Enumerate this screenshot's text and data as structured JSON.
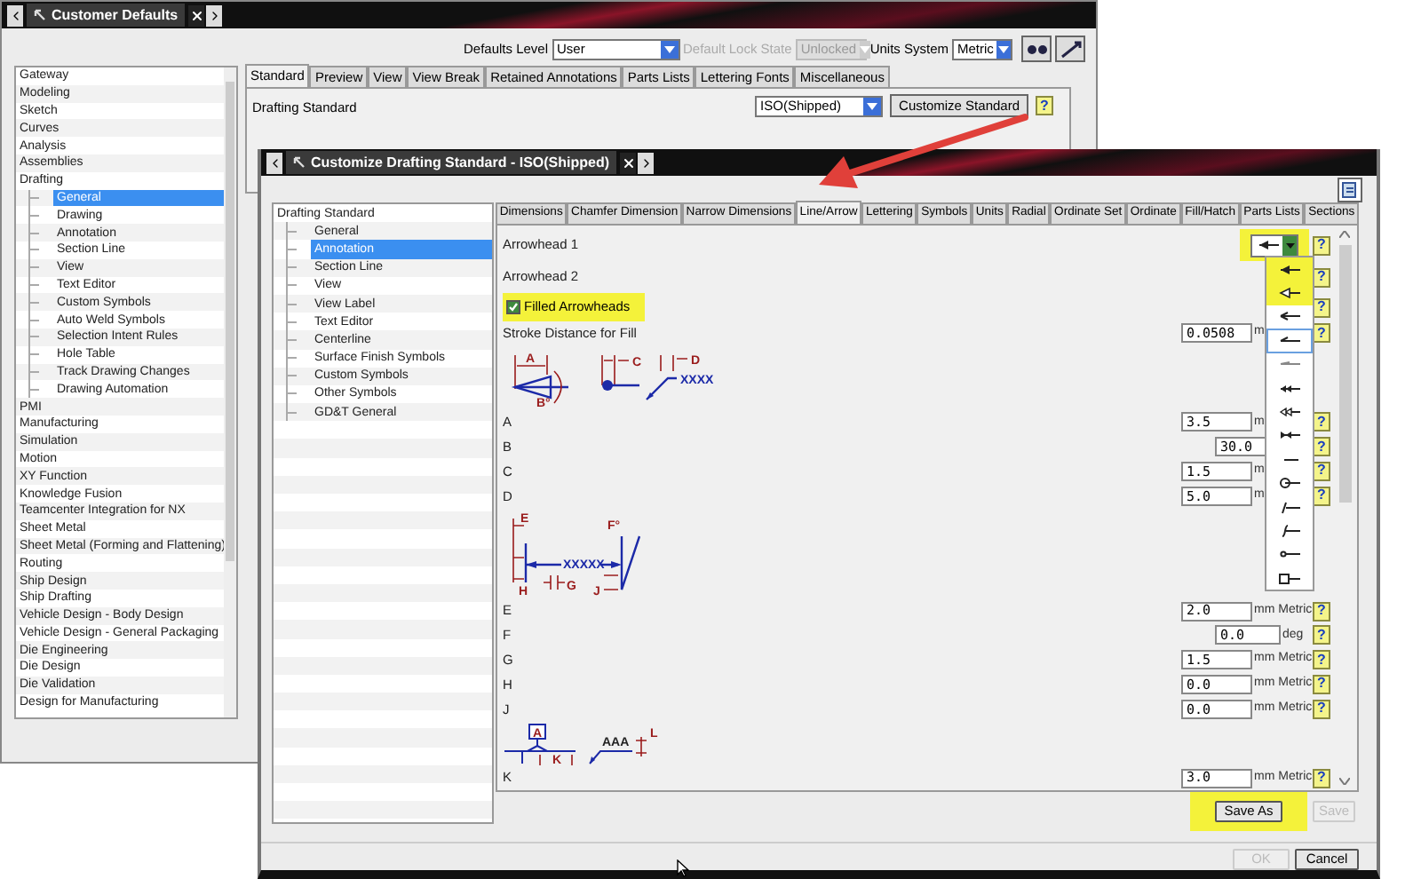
{
  "back_window": {
    "title": "Customer Defaults",
    "toolbar": {
      "defaults_level_label": "Defaults Level",
      "defaults_level": "User",
      "lock_state_label": "Default Lock State",
      "lock_state": "Unlocked",
      "lock_disabled": true,
      "units_label": "Units System",
      "units": "Metric"
    },
    "tree": [
      {
        "label": "Gateway",
        "selected": false
      },
      {
        "label": "Modeling",
        "selected": false
      },
      {
        "label": "Sketch",
        "selected": false
      },
      {
        "label": "Curves",
        "selected": false
      },
      {
        "label": "Analysis",
        "selected": false
      },
      {
        "label": "Assemblies",
        "selected": false
      },
      {
        "label": "Drafting",
        "selected": false,
        "children": [
          {
            "label": "General",
            "selected": true
          },
          {
            "label": "Drawing",
            "selected": false
          },
          {
            "label": "Annotation",
            "selected": false
          },
          {
            "label": "Section Line",
            "selected": false
          },
          {
            "label": "View",
            "selected": false
          },
          {
            "label": "Text Editor",
            "selected": false
          },
          {
            "label": "Custom Symbols",
            "selected": false
          },
          {
            "label": "Auto Weld Symbols",
            "selected": false
          },
          {
            "label": "Selection Intent Rules",
            "selected": false
          },
          {
            "label": "Hole Table",
            "selected": false
          },
          {
            "label": "Track Drawing Changes",
            "selected": false
          },
          {
            "label": "Drawing Automation",
            "selected": false
          }
        ]
      },
      {
        "label": "PMI",
        "selected": false
      },
      {
        "label": "Manufacturing",
        "selected": false
      },
      {
        "label": "Simulation",
        "selected": false
      },
      {
        "label": "Motion",
        "selected": false
      },
      {
        "label": "XY Function",
        "selected": false
      },
      {
        "label": "Knowledge Fusion",
        "selected": false
      },
      {
        "label": "Teamcenter Integration for NX",
        "selected": false
      },
      {
        "label": "Sheet Metal",
        "selected": false
      },
      {
        "label": "Sheet Metal (Forming and Flattening)",
        "selected": false
      },
      {
        "label": "Routing",
        "selected": false
      },
      {
        "label": "Ship Design",
        "selected": false
      },
      {
        "label": "Ship Drafting",
        "selected": false
      },
      {
        "label": "Vehicle Design - Body Design",
        "selected": false
      },
      {
        "label": "Vehicle Design - General Packaging",
        "selected": false
      },
      {
        "label": "Die Engineering",
        "selected": false
      },
      {
        "label": "Die Design",
        "selected": false
      },
      {
        "label": "Die Validation",
        "selected": false
      },
      {
        "label": "Design for Manufacturing",
        "selected": false
      }
    ],
    "tabs": [
      {
        "label": "Standard",
        "selected": true
      },
      {
        "label": "Preview",
        "selected": false
      },
      {
        "label": "View",
        "selected": false
      },
      {
        "label": "View Break",
        "selected": false
      },
      {
        "label": "Retained Annotations",
        "selected": false
      },
      {
        "label": "Parts Lists",
        "selected": false
      },
      {
        "label": "Lettering Fonts",
        "selected": false
      },
      {
        "label": "Miscellaneous",
        "selected": false
      }
    ],
    "drafting_standard": {
      "label": "Drafting Standard",
      "value": "ISO(Shipped)",
      "button": "Customize Standard",
      "help": "?"
    }
  },
  "dialog": {
    "title": "Customize Drafting Standard - ISO(Shipped)",
    "tree": [
      {
        "label": "Drafting Standard",
        "selected": false,
        "children": [
          {
            "label": "General",
            "selected": false
          },
          {
            "label": "Annotation",
            "selected": true
          },
          {
            "label": "Section Line",
            "selected": false
          },
          {
            "label": "View",
            "selected": false
          },
          {
            "label": "View Label",
            "selected": false
          },
          {
            "label": "Text Editor",
            "selected": false
          },
          {
            "label": "Centerline",
            "selected": false
          },
          {
            "label": "Surface Finish Symbols",
            "selected": false
          },
          {
            "label": "Custom Symbols",
            "selected": false
          },
          {
            "label": "Other Symbols",
            "selected": false
          },
          {
            "label": "GD&T General",
            "selected": false
          }
        ]
      }
    ],
    "tabs": [
      {
        "label": "Dimensions",
        "selected": false
      },
      {
        "label": "Chamfer Dimension",
        "selected": false
      },
      {
        "label": "Narrow Dimensions",
        "selected": false
      },
      {
        "label": "Line/Arrow",
        "selected": true
      },
      {
        "label": "Lettering",
        "selected": false
      },
      {
        "label": "Symbols",
        "selected": false
      },
      {
        "label": "Units",
        "selected": false
      },
      {
        "label": "Radial",
        "selected": false
      },
      {
        "label": "Ordinate Set",
        "selected": false
      },
      {
        "label": "Ordinate",
        "selected": false
      },
      {
        "label": "Fill/Hatch",
        "selected": false
      },
      {
        "label": "Parts Lists",
        "selected": false
      },
      {
        "label": "Sections",
        "selected": false
      }
    ],
    "rows": [
      {
        "kind": "dropdown",
        "label": "Arrowhead 1",
        "highlighted": true,
        "help": "?"
      },
      {
        "kind": "label",
        "label": "Arrowhead 2",
        "help": "?"
      },
      {
        "kind": "checkbox",
        "label": "Filled Arrowheads",
        "checked": true,
        "highlighted": true,
        "help": "?"
      },
      {
        "kind": "length",
        "label": "Stroke Distance for Fill",
        "value": "0.0508",
        "unit": "m",
        "help": "?"
      },
      {
        "kind": "diagram_arrow",
        "labels": [
          "A",
          "B°",
          "C",
          "D",
          "XXXX"
        ]
      },
      {
        "kind": "length",
        "label": "A",
        "value": "3.5",
        "unit": "m",
        "help": "?"
      },
      {
        "kind": "angle",
        "label": "B",
        "value": "30.0",
        "help": "?"
      },
      {
        "kind": "length",
        "label": "C",
        "value": "1.5",
        "unit": "m",
        "help": "?"
      },
      {
        "kind": "length",
        "label": "D",
        "value": "5.0",
        "unit": "m",
        "help": "?"
      },
      {
        "kind": "diagram_extension",
        "labels": [
          "E",
          "H",
          "G",
          "XXXXX",
          "F°",
          "J"
        ]
      },
      {
        "kind": "length",
        "label": "E",
        "value": "2.0",
        "unit": "mm Metric",
        "help": "?"
      },
      {
        "kind": "angle",
        "label": "F",
        "value": "0.0",
        "unit": "deg",
        "help": "?"
      },
      {
        "kind": "length",
        "label": "G",
        "value": "1.5",
        "unit": "mm Metric",
        "help": "?"
      },
      {
        "kind": "length",
        "label": "H",
        "value": "0.0",
        "unit": "mm Metric",
        "help": "?"
      },
      {
        "kind": "length",
        "label": "J",
        "value": "0.0",
        "unit": "mm Metric",
        "help": "?"
      },
      {
        "kind": "diagram_datum",
        "labels": [
          "A",
          "K",
          "AAA",
          "L"
        ]
      },
      {
        "kind": "length",
        "label": "K",
        "value": "3.0",
        "unit": "mm Metric",
        "help": "?"
      }
    ],
    "arrowhead_options": [
      {
        "kind": "filled",
        "selected": false,
        "highlighted": true
      },
      {
        "kind": "open",
        "selected": false,
        "highlighted": true
      },
      {
        "kind": "line",
        "selected": false,
        "highlighted": false
      },
      {
        "kind": "half",
        "selected": true,
        "highlighted": false
      },
      {
        "kind": "thin",
        "selected": false,
        "highlighted": false
      },
      {
        "kind": "double_filled",
        "selected": false,
        "highlighted": false
      },
      {
        "kind": "double_open",
        "selected": false,
        "highlighted": false
      },
      {
        "kind": "back",
        "selected": false,
        "highlighted": false
      },
      {
        "kind": "none",
        "selected": false,
        "highlighted": false
      },
      {
        "kind": "circle",
        "selected": false,
        "highlighted": false
      },
      {
        "kind": "slash",
        "selected": false,
        "highlighted": false
      },
      {
        "kind": "integral",
        "selected": false,
        "highlighted": false
      },
      {
        "kind": "small_circle",
        "selected": false,
        "highlighted": false
      },
      {
        "kind": "square",
        "selected": false,
        "highlighted": false
      }
    ],
    "buttons": {
      "save_as": {
        "label": "Save As",
        "highlighted": true,
        "disabled": false
      },
      "save": {
        "label": "Save",
        "disabled": true
      },
      "ok": {
        "label": "OK",
        "disabled": true
      },
      "cancel": {
        "label": "Cancel",
        "disabled": false
      }
    }
  }
}
